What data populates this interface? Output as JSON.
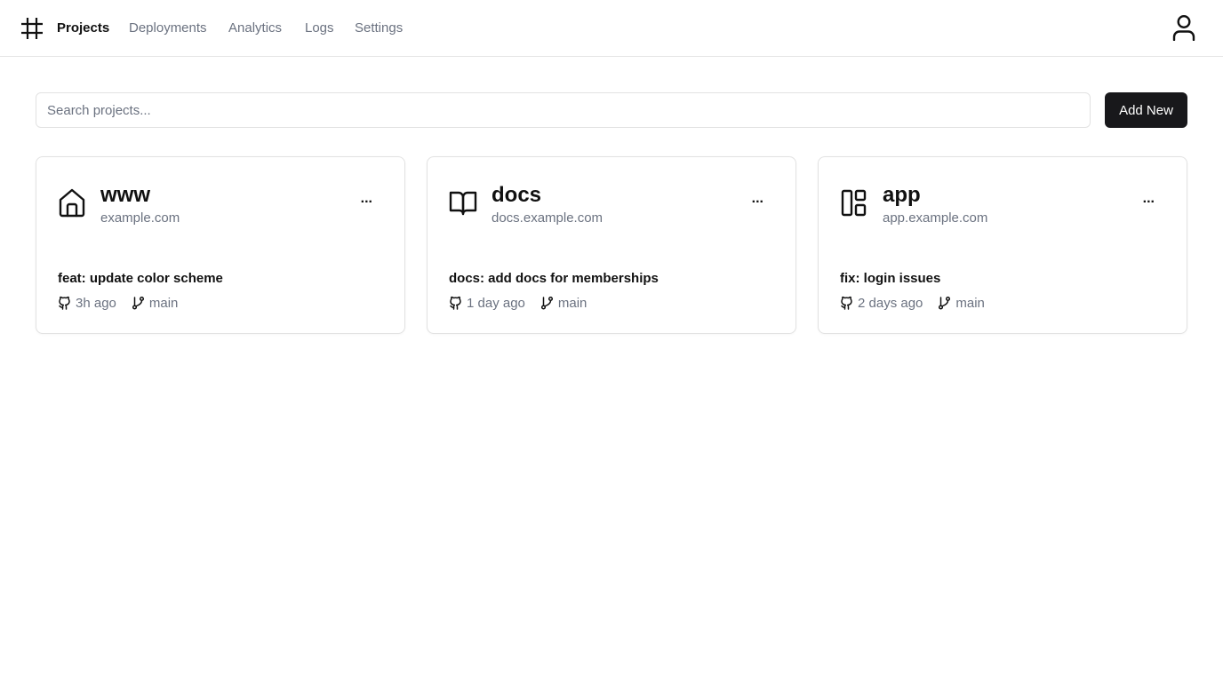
{
  "nav": {
    "logo_icon": "hash-icon",
    "items": [
      {
        "label": "Projects",
        "active": true
      },
      {
        "label": "Deployments",
        "active": false
      },
      {
        "label": "Analytics",
        "active": false
      },
      {
        "label": "Logs",
        "active": false
      },
      {
        "label": "Settings",
        "active": false
      }
    ],
    "user_icon": "user-icon"
  },
  "search": {
    "placeholder": "Search projects...",
    "value": ""
  },
  "actions": {
    "add_new_label": "Add New"
  },
  "projects": [
    {
      "name": "www",
      "domain": "example.com",
      "icon": "home-icon",
      "menu_label": "...",
      "commit_message": "feat: update color scheme",
      "time_ago": "3h ago",
      "branch": "main"
    },
    {
      "name": "docs",
      "domain": "docs.example.com",
      "icon": "book-open-icon",
      "menu_label": "...",
      "commit_message": "docs: add docs for memberships",
      "time_ago": "1 day ago",
      "branch": "main"
    },
    {
      "name": "app",
      "domain": "app.example.com",
      "icon": "layout-dashboard-icon",
      "menu_label": "...",
      "commit_message": "fix: login issues",
      "time_ago": "2 days ago",
      "branch": "main"
    }
  ],
  "colors": {
    "accent_dark": "#18181b",
    "muted_text": "#6b7280",
    "border": "#e2e2e2"
  }
}
